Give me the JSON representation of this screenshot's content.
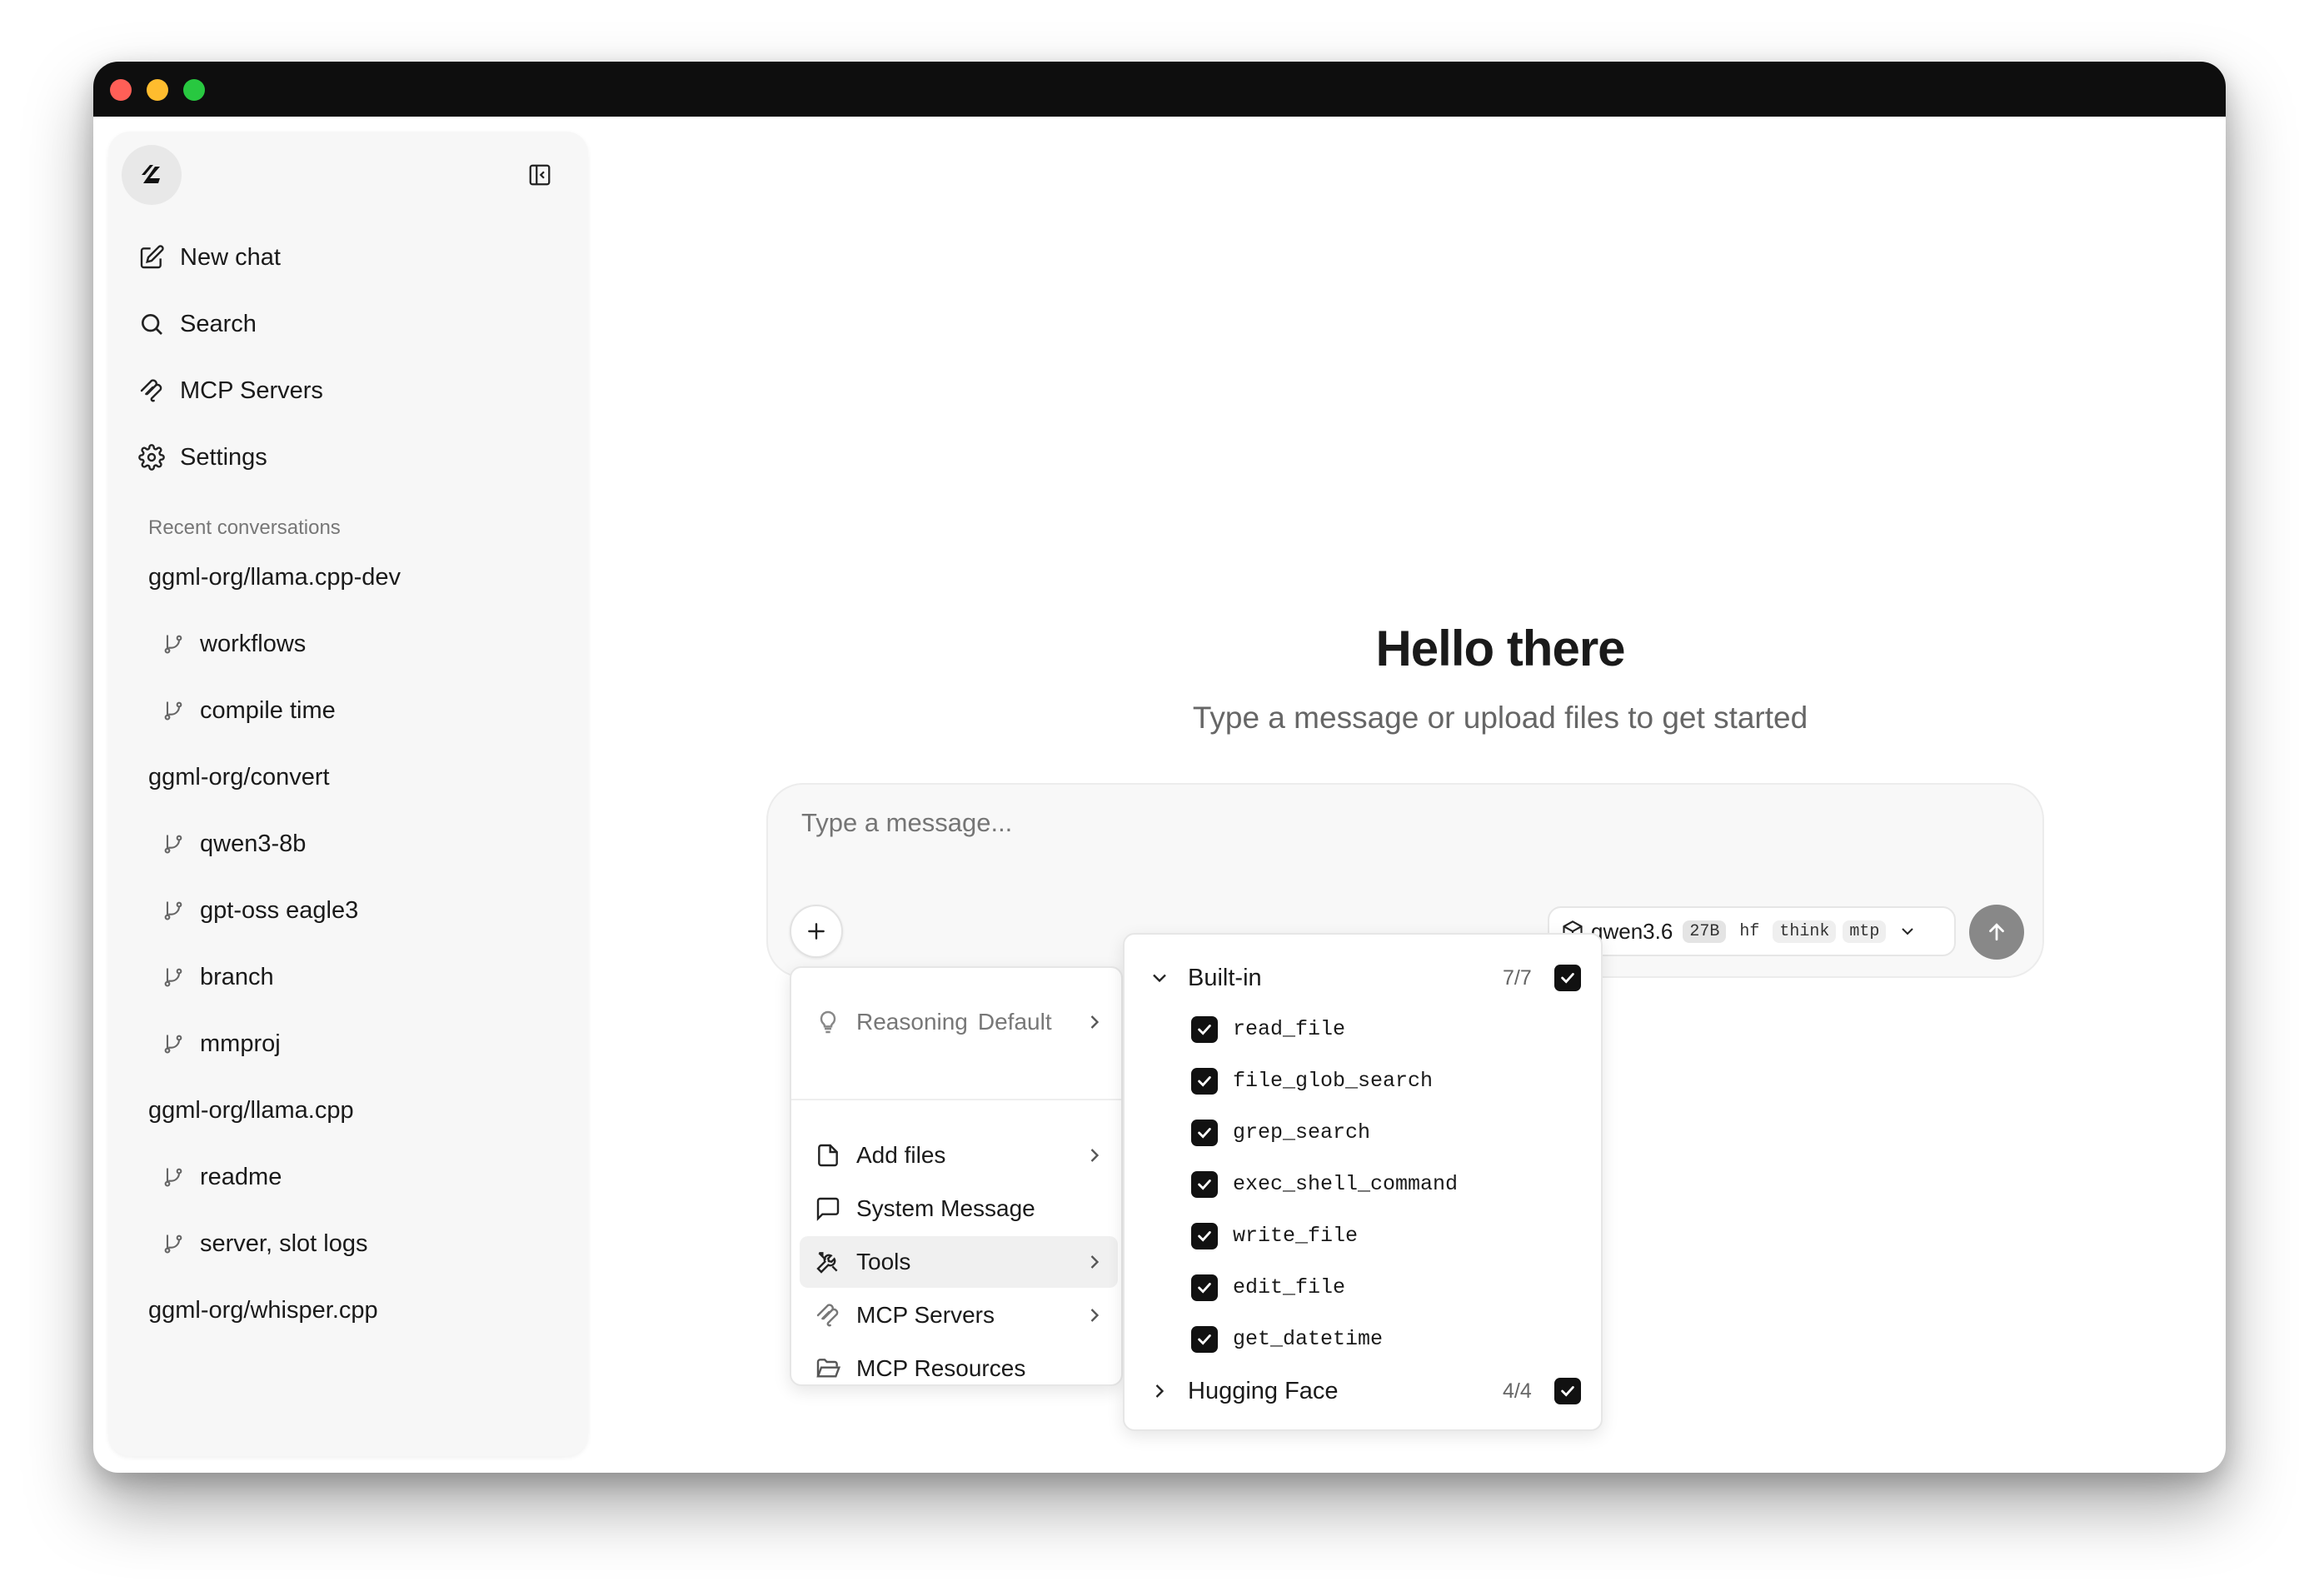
{
  "sidebar": {
    "nav": [
      {
        "label": "New chat",
        "icon": "edit-icon"
      },
      {
        "label": "Search",
        "icon": "search-icon"
      },
      {
        "label": "MCP Servers",
        "icon": "mcp-icon"
      },
      {
        "label": "Settings",
        "icon": "gear-icon"
      }
    ],
    "section_label": "Recent conversations",
    "conversations": [
      {
        "label": "ggml-org/llama.cpp-dev",
        "branch": false
      },
      {
        "label": "workflows",
        "branch": true
      },
      {
        "label": "compile time",
        "branch": true
      },
      {
        "label": "ggml-org/convert",
        "branch": false
      },
      {
        "label": "qwen3-8b",
        "branch": true
      },
      {
        "label": "gpt-oss eagle3",
        "branch": true
      },
      {
        "label": "branch",
        "branch": true
      },
      {
        "label": "mmproj",
        "branch": true
      },
      {
        "label": "ggml-org/llama.cpp",
        "branch": false
      },
      {
        "label": "readme",
        "branch": true
      },
      {
        "label": "server, slot logs",
        "branch": true
      },
      {
        "label": "ggml-org/whisper.cpp",
        "branch": false
      }
    ]
  },
  "main": {
    "title": "Hello there",
    "subtitle": "Type a message or upload files to get started"
  },
  "composer": {
    "placeholder": "Type a message...",
    "model": {
      "name": "qwen3.6",
      "tags": [
        "27B",
        "hf",
        "think",
        "mtp"
      ]
    }
  },
  "menu": {
    "reasoning_label": "Reasoning",
    "reasoning_value": "Default",
    "items": [
      {
        "label": "Add files",
        "submenu": true
      },
      {
        "label": "System Message",
        "submenu": false
      },
      {
        "label": "Tools",
        "submenu": true,
        "active": true
      },
      {
        "label": "MCP Servers",
        "submenu": true
      },
      {
        "label": "MCP Resources",
        "submenu": false
      }
    ]
  },
  "tools": {
    "groups": [
      {
        "name": "Built-in",
        "count": "7/7",
        "expanded": true,
        "tools": [
          "read_file",
          "file_glob_search",
          "grep_search",
          "exec_shell_command",
          "write_file",
          "edit_file",
          "get_datetime"
        ]
      },
      {
        "name": "Hugging Face",
        "count": "4/4",
        "expanded": false,
        "tools": []
      }
    ]
  }
}
